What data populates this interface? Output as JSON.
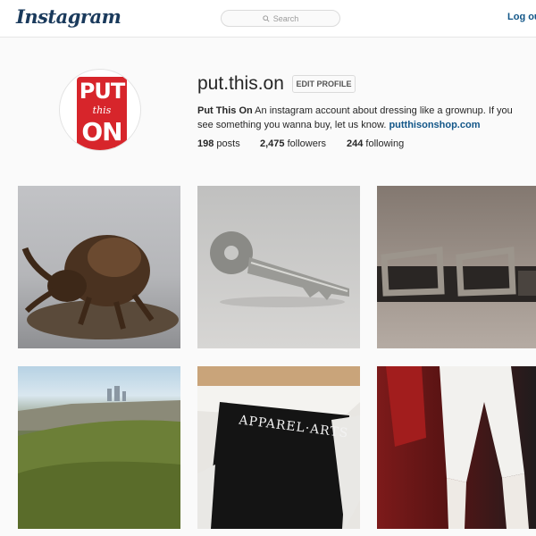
{
  "header": {
    "logo_text": "Instagram",
    "search_placeholder": "Search",
    "logout_label": "Log out"
  },
  "profile": {
    "avatar_text": {
      "line1": "PUT",
      "line2": "this",
      "line3": "ON"
    },
    "username": "put.this.on",
    "edit_button_label": "EDIT PROFILE",
    "full_name": "Put This On",
    "bio": " An instagram account about dressing like a grownup. If you see something you wanna buy, let us know. ",
    "website": "putthisonshop.com",
    "stats": {
      "posts_count": "198",
      "posts_label": " posts",
      "followers_count": "2,475",
      "followers_label": " followers",
      "following_count": "244",
      "following_label": " following"
    }
  },
  "posts": [
    {
      "icon": "beetle-figurine-photo"
    },
    {
      "icon": "key-photo"
    },
    {
      "icon": "belt-buckles-photo"
    },
    {
      "icon": "hillside-landscape-photo"
    },
    {
      "icon": "apparel-arts-book-photo",
      "caption": "APPAREL·ARTS"
    },
    {
      "icon": "white-scarf-photo"
    }
  ],
  "colors": {
    "link": "#125688",
    "avatar_red": "#d7252b",
    "background": "#fafafa"
  }
}
